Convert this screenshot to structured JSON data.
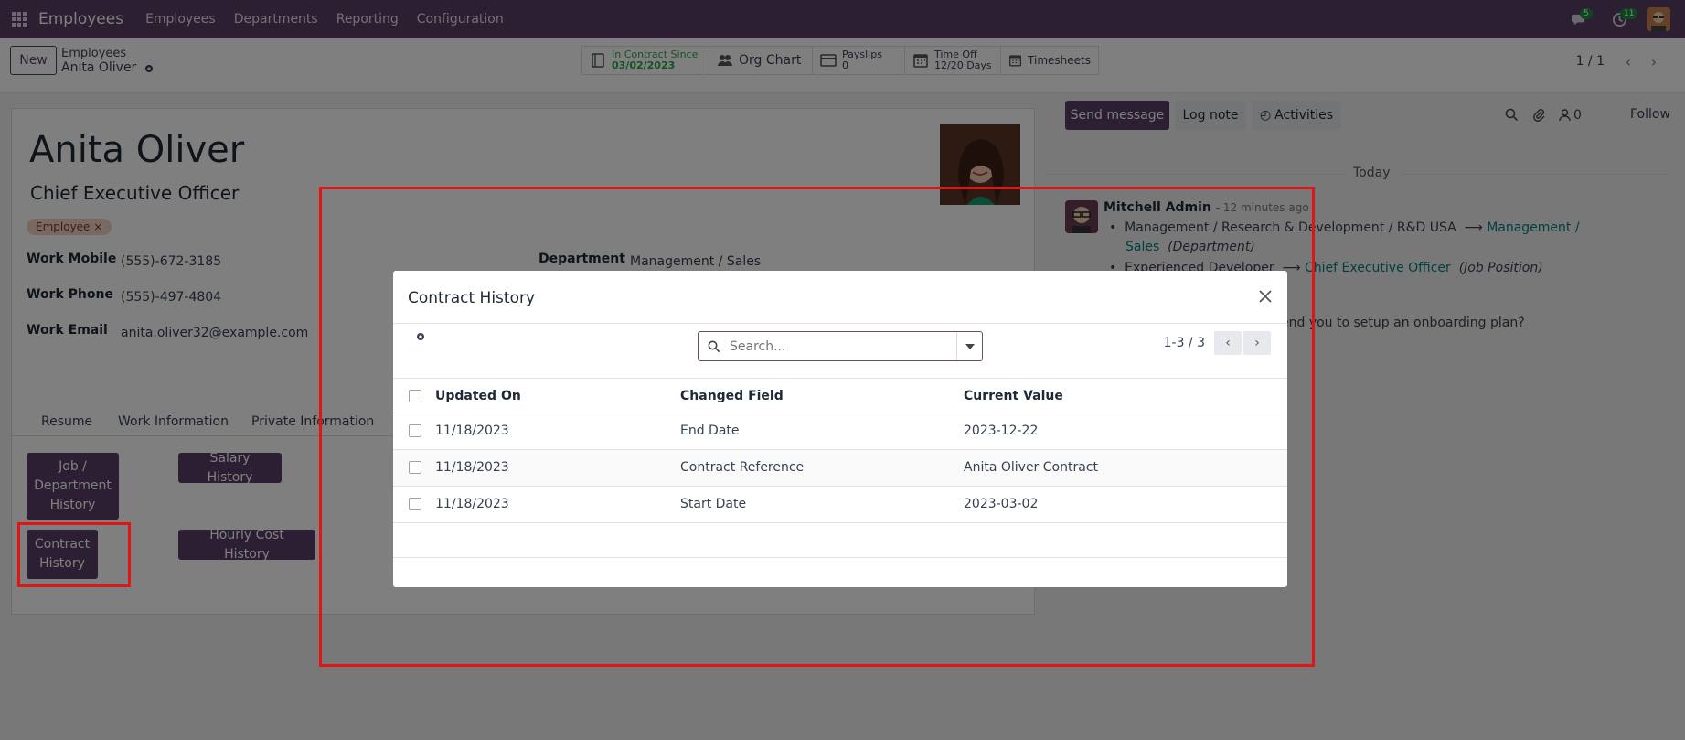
{
  "nav": {
    "brand": "Employees",
    "items": [
      "Employees",
      "Departments",
      "Reporting",
      "Configuration"
    ],
    "messages_badge": "5",
    "activities_badge": "11"
  },
  "control": {
    "new_label": "New",
    "breadcrumb_parent": "Employees",
    "breadcrumb_current": "Anita Oliver",
    "smart_contract_l1": "In Contract Since",
    "smart_contract_l2": "03/02/2023",
    "smart_org": "Org Chart",
    "smart_payslips_l1": "Payslips",
    "smart_payslips_l2": "0",
    "smart_timeoff_l1": "Time Off",
    "smart_timeoff_l2": "12/20 Days",
    "smart_timesheets": "Timesheets",
    "pager": "1 / 1"
  },
  "form": {
    "name": "Anita Oliver",
    "job_title": "Chief Executive Officer",
    "tag": "Employee",
    "work_mobile_label": "Work Mobile",
    "work_mobile": "(555)-672-3185",
    "work_phone_label": "Work Phone",
    "work_phone": "(555)-497-4804",
    "work_email_label": "Work Email",
    "work_email": "anita.oliver32@example.com",
    "department_label": "Department",
    "department": "Management / Sales",
    "tabs": [
      "Resume",
      "Work Information",
      "Private Information"
    ],
    "btn_job_history": "Job / Department History",
    "btn_salary_history": "Salary History",
    "btn_contract_history": "Contract History",
    "btn_hourly_cost": "Hourly Cost History"
  },
  "chatter": {
    "send_message": "Send message",
    "log_note": "Log note",
    "activities": "Activities",
    "followers_count": "0",
    "follow": "Follow",
    "today": "Today",
    "author": "Mitchell Admin",
    "time": "- 12 minutes ago",
    "line1_old": "Management / Research & Development / R&D USA",
    "line1_new_a": "Management /",
    "line1_new_b": "Sales",
    "line1_field": "(Department)",
    "line2_old": "Experienced Developer",
    "line2_new": "Chief Executive Officer",
    "line2_field": "(Job Position)",
    "onboarding_text": "end you to setup an",
    "onboarding_link": "onboarding plan?"
  },
  "dialog": {
    "title": "Contract History",
    "search_placeholder": "Search...",
    "pager": "1-3 / 3",
    "columns": [
      "Updated On",
      "Changed Field",
      "Current Value"
    ],
    "rows": [
      {
        "updated_on": "11/18/2023",
        "changed_field": "End Date",
        "current_value": "2023-12-22"
      },
      {
        "updated_on": "11/18/2023",
        "changed_field": "Contract Reference",
        "current_value": "Anita Oliver Contract"
      },
      {
        "updated_on": "11/18/2023",
        "changed_field": "Start Date",
        "current_value": "2023-03-02"
      }
    ]
  },
  "colors": {
    "brand": "#593e65",
    "primary_button": "#5b3f66",
    "highlight": "#e01515",
    "link": "#017e84"
  }
}
